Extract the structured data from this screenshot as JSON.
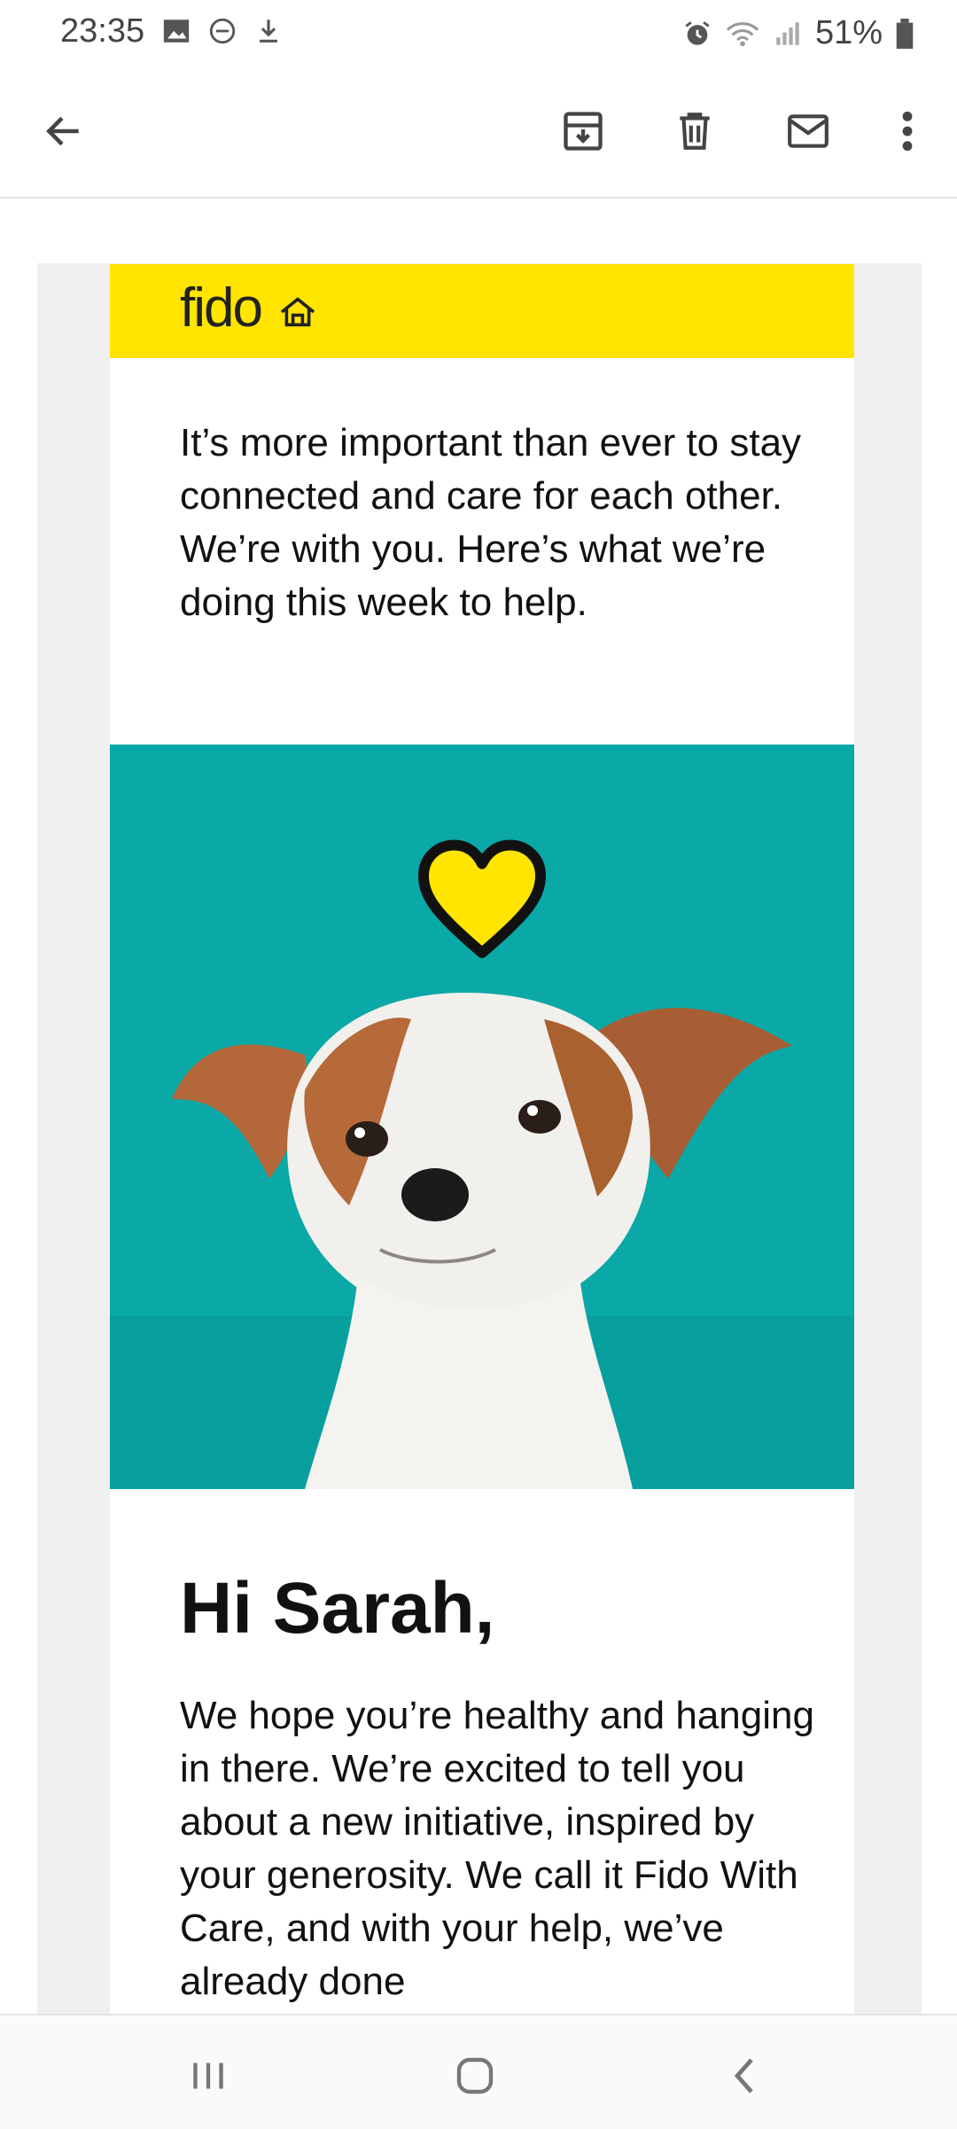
{
  "status_bar": {
    "time": "23:35",
    "battery": "51%",
    "left_icons": [
      "image-icon",
      "do-not-disturb-icon",
      "download-icon"
    ],
    "right_icons": [
      "alarm-icon",
      "wifi-icon",
      "signal-icon",
      "battery-icon"
    ]
  },
  "app_bar": {
    "icons": [
      "back-arrow-icon",
      "archive-icon",
      "delete-icon",
      "mail-icon",
      "more-vert-icon"
    ]
  },
  "email": {
    "brand": "fido",
    "brand_color": "#ffe500",
    "intro_line1": "It’s more important than ever to stay connected and care for each other.",
    "intro_line2": "We’re with you. Here’s what we’re doing this week to help.",
    "hero_bg": "#0aa8a6",
    "greeting": "Hi Sarah,",
    "body": "We hope you’re healthy and hanging in there. We’re excited to tell you about a new initiative, inspired by your generosity. We call it Fido With Care, and with your help, we’ve already done"
  },
  "nav_bar": {
    "icons": [
      "recent-apps-icon",
      "home-icon",
      "back-icon"
    ]
  }
}
